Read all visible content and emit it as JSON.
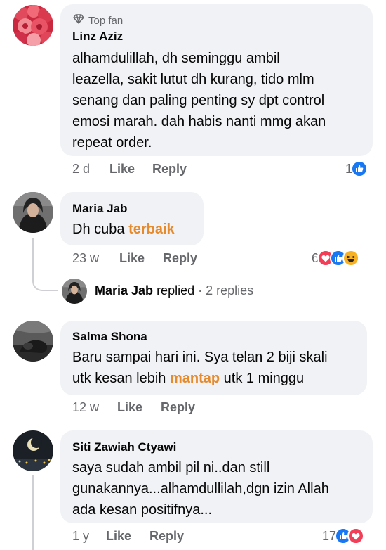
{
  "comments": [
    {
      "badge": "Top fan",
      "author": "Linz Aziz",
      "lines": [
        "alhamdulillah, dh seminggu ambil",
        "leazella, sakit lutut dh kurang, tido mlm",
        "senang dan paling penting sy dpt control",
        "emosi marah. dah habis nanti mmg akan",
        "repeat order."
      ],
      "time": "2 d",
      "like": "Like",
      "reply": "Reply",
      "reaction_count": "1"
    },
    {
      "author": "Maria Jab",
      "text_pre": "Dh cuba ",
      "text_hl": "terbaik",
      "time": "23 w",
      "like": "Like",
      "reply": "Reply",
      "reaction_count": "6",
      "replies_summary": {
        "author": "Maria Jab",
        "action": "replied",
        "count": "· 2 replies"
      }
    },
    {
      "author": "Salma Shona",
      "line1": "Baru sampai hari ini. Sya telan 2 biji skali",
      "line2_pre": "utk kesan lebih ",
      "line2_hl": "mantap",
      "line2_post": " utk 1 minggu",
      "time": "12 w",
      "like": "Like",
      "reply": "Reply"
    },
    {
      "author": "Siti Zawiah Ctyawi",
      "lines": [
        "saya sudah ambil pil ni..dan still",
        "gunakannya...alhamdullilah,dgn izin Allah",
        "ada kesan positifnya..."
      ],
      "time": "1 y",
      "like": "Like",
      "reply": "Reply",
      "reaction_count": "17"
    }
  ],
  "colors": {
    "bubble": "#f0f2f5",
    "highlight": "#e68a2e",
    "like_blue": "#1877f2",
    "love_red": "#f33e58",
    "haha_yellow": "#f7b125"
  },
  "icons": [
    "diamond-icon",
    "like-reaction-icon",
    "love-reaction-icon",
    "haha-reaction-icon"
  ]
}
